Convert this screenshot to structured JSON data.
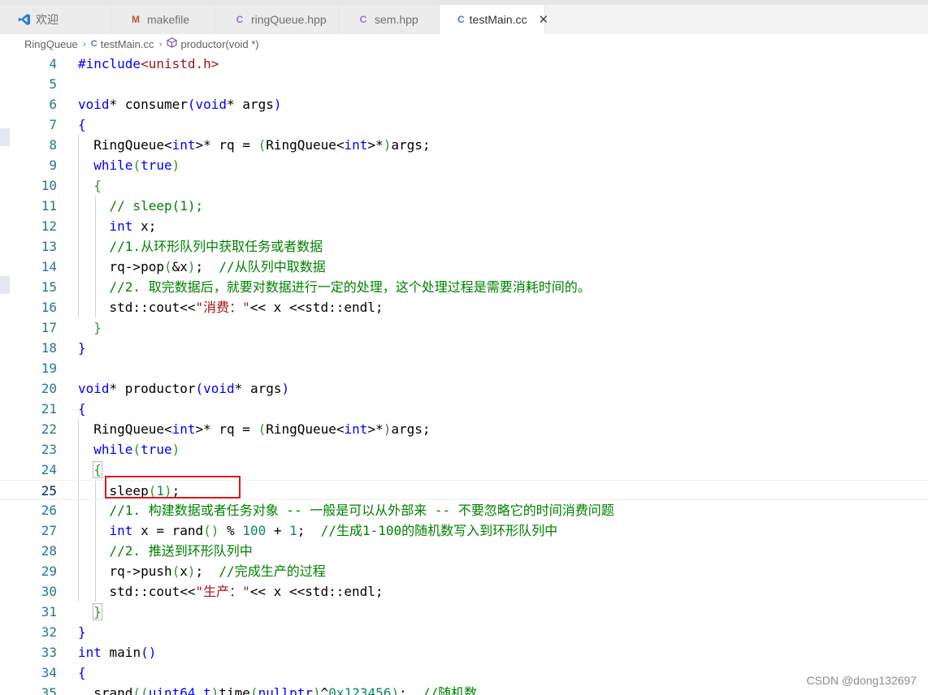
{
  "tabs": [
    {
      "label": "欢迎",
      "icon": "vscode-logo-icon",
      "active": false
    },
    {
      "label": "makefile",
      "icon": "makefile-icon",
      "active": false
    },
    {
      "label": "ringQueue.hpp",
      "icon": "cpp-file-icon",
      "active": false
    },
    {
      "label": "sem.hpp",
      "icon": "cpp-file-icon",
      "active": false
    },
    {
      "label": "testMain.cc",
      "icon": "cpp-file-icon",
      "active": true
    }
  ],
  "breadcrumb": {
    "folder": "RingQueue",
    "file": "testMain.cc",
    "symbol": "productor(void *)"
  },
  "colors": {
    "keyword": "#0000ff",
    "comment": "#008000",
    "string": "#a31515",
    "number": "#098658",
    "line_number": "#237893",
    "highlight_box": "#e0161b"
  },
  "editor": {
    "lines": [
      {
        "n": "4",
        "text": "#include<unistd.h>"
      },
      {
        "n": "5",
        "text": ""
      },
      {
        "n": "6",
        "text": "void* consumer(void* args)"
      },
      {
        "n": "7",
        "text": "{"
      },
      {
        "n": "8",
        "text": "  RingQueue<int>* rq = (RingQueue<int>*)args;"
      },
      {
        "n": "9",
        "text": "  while(true)"
      },
      {
        "n": "10",
        "text": "  {"
      },
      {
        "n": "11",
        "text": "    // sleep(1);"
      },
      {
        "n": "12",
        "text": "    int x;"
      },
      {
        "n": "13",
        "text": "    //1.从环形队列中获取任务或者数据"
      },
      {
        "n": "14",
        "text": "    rq->pop(&x);  //从队列中取数据"
      },
      {
        "n": "15",
        "text": "    //2. 取完数据后，就要对数据进行一定的处理，这个处理过程是需要消耗时间的。"
      },
      {
        "n": "16",
        "text": "    std::cout<<\"消费：\"<< x <<std::endl;"
      },
      {
        "n": "17",
        "text": "  }"
      },
      {
        "n": "18",
        "text": "}"
      },
      {
        "n": "19",
        "text": ""
      },
      {
        "n": "20",
        "text": "void* productor(void* args)"
      },
      {
        "n": "21",
        "text": "{"
      },
      {
        "n": "22",
        "text": "  RingQueue<int>* rq = (RingQueue<int>*)args;"
      },
      {
        "n": "23",
        "text": "  while(true)"
      },
      {
        "n": "24",
        "text": "  {"
      },
      {
        "n": "25",
        "text": "    sleep(1);"
      },
      {
        "n": "26",
        "text": "    //1. 构建数据或者任务对象 -- 一般是可以从外部来 -- 不要忽略它的时间消费问题"
      },
      {
        "n": "27",
        "text": "    int x = rand() % 100 + 1;  //生成1-100的随机数写入到环形队列中"
      },
      {
        "n": "28",
        "text": "    //2. 推送到环形队列中"
      },
      {
        "n": "29",
        "text": "    rq->push(x);  //完成生产的过程"
      },
      {
        "n": "30",
        "text": "    std::cout<<\"生产：\"<< x <<std::endl;"
      },
      {
        "n": "31",
        "text": "  }"
      },
      {
        "n": "32",
        "text": "}"
      },
      {
        "n": "33",
        "text": "int main()"
      },
      {
        "n": "34",
        "text": "{"
      },
      {
        "n": "35",
        "text": "  srand((uint64_t)time(nullptr)^0x123456);  //随机数"
      }
    ]
  },
  "watermark": "CSDN @dong132697"
}
